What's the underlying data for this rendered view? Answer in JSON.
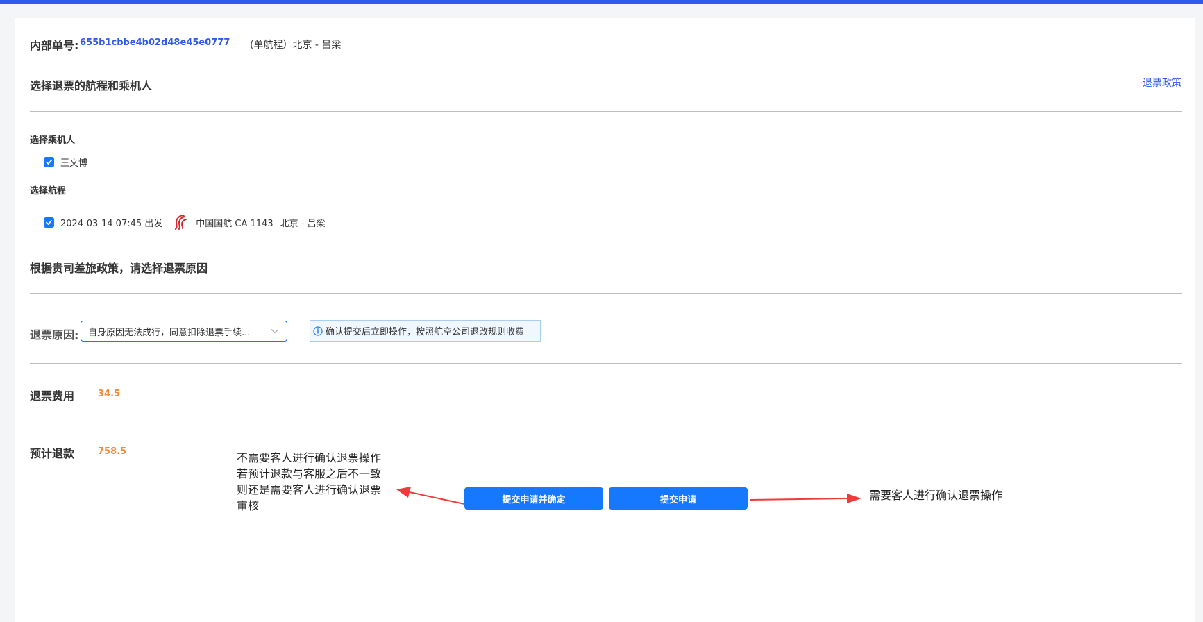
{
  "order": {
    "label": "内部单号:",
    "number": "655b1cbbe4b02d48e45e0777",
    "route_summary": "(单航程）北京 - 吕梁"
  },
  "selection_section": {
    "title": "选择退票的航程和乘机人",
    "policy_link": "退票政策",
    "passengers_title": "选择乘机人",
    "passengers": [
      {
        "name": "王文博",
        "checked": true
      }
    ],
    "segments_title": "选择航程",
    "segments": [
      {
        "checked": true,
        "departure": "2024-03-14 07:45 出发",
        "airline_flight": "中国国航 CA 1143",
        "route": "北京 - 吕梁",
        "logo_icon": "air-china-logo-icon"
      }
    ]
  },
  "reason_section": {
    "title": "根据贵司差旅政策，请选择退票原因",
    "label": "退票原因:",
    "selected_reason": "自身原因无法成行，同意扣除退票手续...",
    "notice": "确认提交后立即操作，按照航空公司退改规则收费"
  },
  "fees": {
    "refund_fee_label": "退票费用",
    "refund_fee_value": "34.5",
    "estimated_refund_label": "预计退款",
    "estimated_refund_value": "758.5"
  },
  "buttons": {
    "submit_confirm": "提交申请并确定",
    "submit": "提交申请"
  },
  "annotations": {
    "left_lines": [
      "不需要客人进行确认退票操作",
      "若预计退款与客服之后不一致",
      "则还是需要客人进行确认退票",
      "审核"
    ],
    "right_text": "需要客人进行确认退票操作"
  },
  "colors": {
    "accent": "#1677ff",
    "link": "#2f5bea",
    "fee": "#f5893b",
    "annotation_arrow": "#ee3b3b",
    "air_china_red": "#d7282f"
  }
}
